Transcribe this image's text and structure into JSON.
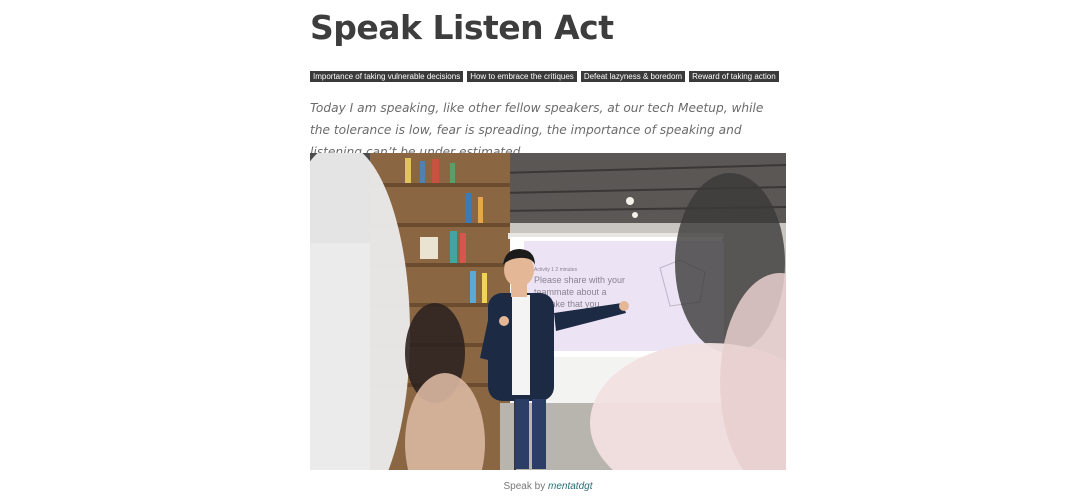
{
  "article": {
    "title": "Speak Listen Act",
    "tags": [
      "Importance of taking vulnerable decisions",
      "How to embrace the critiques",
      "Defeat lazyness & boredom",
      "Reward of taking action"
    ],
    "lead": "Today I am speaking, like other fellow speakers, at our tech Meetup, while the tolerance is low, fear is spreading, the importance of speaking and listening can’t be under estimated.",
    "figure": {
      "caption_prefix": "Speak by",
      "caption_author": "mentatdgt",
      "screen_lines": [
        "Activity 1 2 minutes",
        "Please share with your",
        "teammate about a",
        "mistake that you"
      ]
    }
  }
}
